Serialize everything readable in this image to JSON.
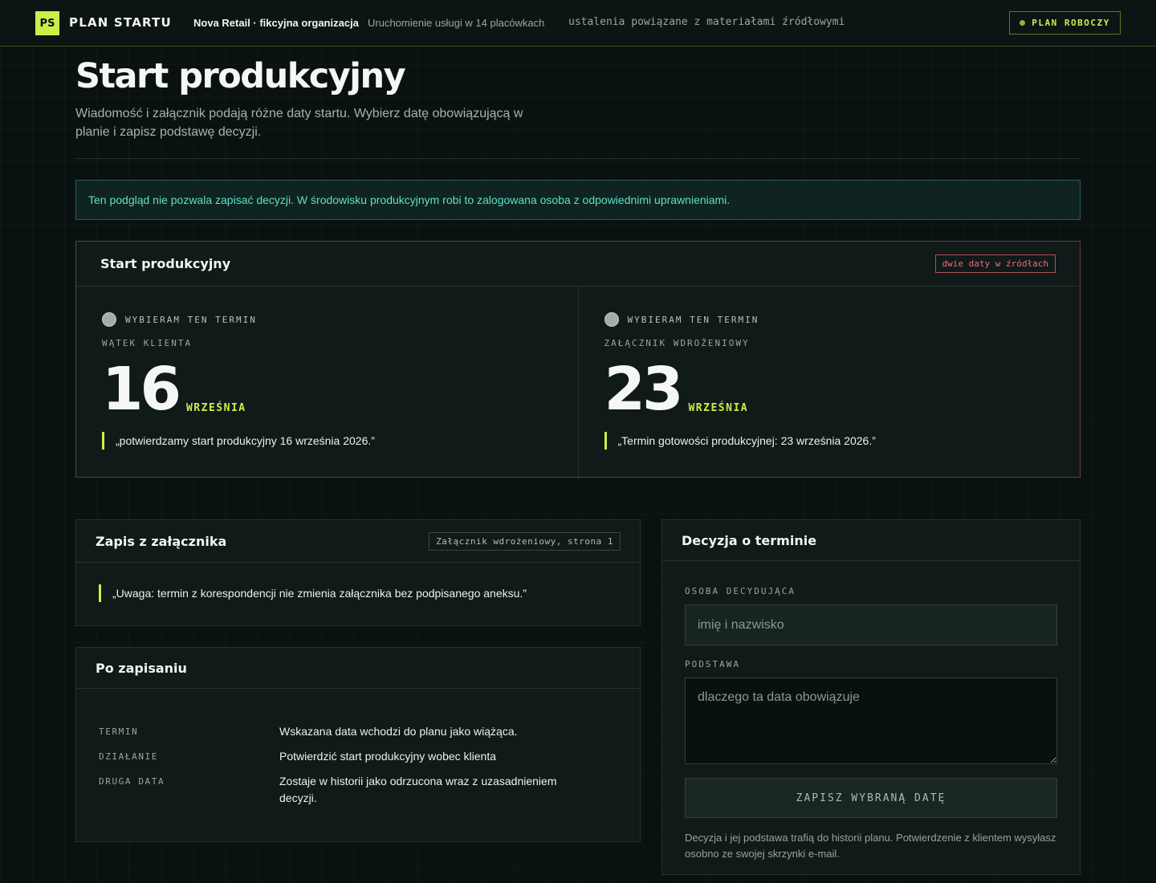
{
  "header": {
    "logo": "PS",
    "app_name": "PLAN STARTU",
    "org": "Nova Retail · fikcyjna organizacja",
    "project": "Uruchomienie usługi w 14 placówkach",
    "note": "ustalenia powiązane z materiałami źródłowymi",
    "status": "PLAN ROBOCZY"
  },
  "page": {
    "title": "Start produkcyjny",
    "subtitle": "Wiadomość i załącznik podają różne daty startu. Wybierz datę obowiązującą w planie i zapisz podstawę decyzji.",
    "notice": "Ten podgląd nie pozwala zapisać decyzji. W środowisku produkcyjnym robi to zalogowana osoba z odpowiednimi uprawnieniami."
  },
  "conflict": {
    "title": "Start produkcyjny",
    "tag": "dwie daty w źródłach",
    "options": [
      {
        "radio_label": "WYBIERAM TEN TERMIN",
        "source": "WĄTEK KLIENTA",
        "day": "16",
        "month": "WRZEŚNIA",
        "quote": "„potwierdzamy start produkcyjny 16 września 2026.”"
      },
      {
        "radio_label": "WYBIERAM TEN TERMIN",
        "source": "ZAŁĄCZNIK WDROŻENIOWY",
        "day": "23",
        "month": "WRZEŚNIA",
        "quote": "„Termin gotowości produkcyjnej: 23 września 2026.”"
      }
    ]
  },
  "attachment": {
    "title": "Zapis z załącznika",
    "page_ref": "Załącznik wdrożeniowy, strona 1",
    "quote": "„Uwaga: termin z korespondencji nie zmienia załącznika bez podpisanego aneksu.”"
  },
  "after": {
    "title": "Po zapisaniu",
    "rows": [
      {
        "key": "TERMIN",
        "value": "Wskazana data wchodzi do planu jako wiążąca."
      },
      {
        "key": "DZIAŁANIE",
        "value": "Potwierdzić start produkcyjny wobec klienta"
      },
      {
        "key": "DRUGA DATA",
        "value": "Zostaje w historii jako odrzucona wraz z uzasadnieniem decyzji."
      }
    ]
  },
  "decision": {
    "title": "Decyzja o terminie",
    "person_label": "OSOBA DECYDUJĄCA",
    "person_placeholder": "imię i nazwisko",
    "basis_label": "PODSTAWA",
    "basis_placeholder": "dlaczego ta data obowiązuje",
    "save_label": "ZAPISZ WYBRANĄ DATĘ",
    "note": "Decyzja i jej podstawa trafią do historii planu. Potwierdzenie z klientem wysyłasz osobno ze swojej skrzynki e-mail."
  },
  "colors": {
    "accent": "#c9f04a",
    "notice_text": "#5fe0c6",
    "conflict": "#ef6a7a",
    "background": "#0a1211"
  }
}
